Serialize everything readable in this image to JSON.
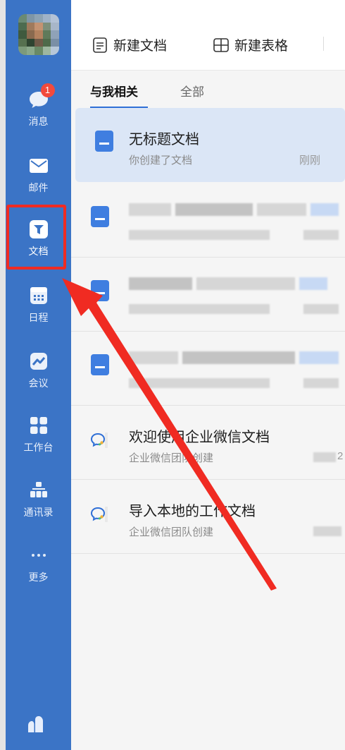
{
  "sidebar": {
    "items": [
      {
        "label": "消息",
        "icon": "chat-bubble-icon",
        "badge": "1"
      },
      {
        "label": "邮件",
        "icon": "mail-icon"
      },
      {
        "label": "文档",
        "icon": "document-icon"
      },
      {
        "label": "日程",
        "icon": "calendar-icon"
      },
      {
        "label": "会议",
        "icon": "meeting-icon"
      },
      {
        "label": "工作台",
        "icon": "grid-icon"
      },
      {
        "label": "通讯录",
        "icon": "contacts-icon"
      },
      {
        "label": "更多",
        "icon": "more-dots-icon"
      }
    ]
  },
  "toolbar": {
    "new_doc_label": "新建文档",
    "new_sheet_label": "新建表格"
  },
  "tabs": {
    "related_label": "与我相关",
    "all_label": "全部"
  },
  "docs": [
    {
      "title": "无标题文档",
      "subtitle": "你创建了文档",
      "time": "刚刚"
    },
    {
      "title": "",
      "subtitle": "",
      "time": ""
    },
    {
      "title": "",
      "subtitle": "",
      "time": ""
    },
    {
      "title": "",
      "subtitle": "",
      "time": ""
    },
    {
      "title": "欢迎使用企业微信文档",
      "subtitle": "企业微信团队创建",
      "time": "2"
    },
    {
      "title": "导入本地的工作文档",
      "subtitle": "企业微信团队创建",
      "time": ""
    }
  ],
  "colors": {
    "sidebar_bg": "#3b74c6",
    "accent": "#2f6fd6",
    "highlight_box": "#f02b22",
    "arrow": "#f02b22",
    "badge": "#f24a3c"
  }
}
